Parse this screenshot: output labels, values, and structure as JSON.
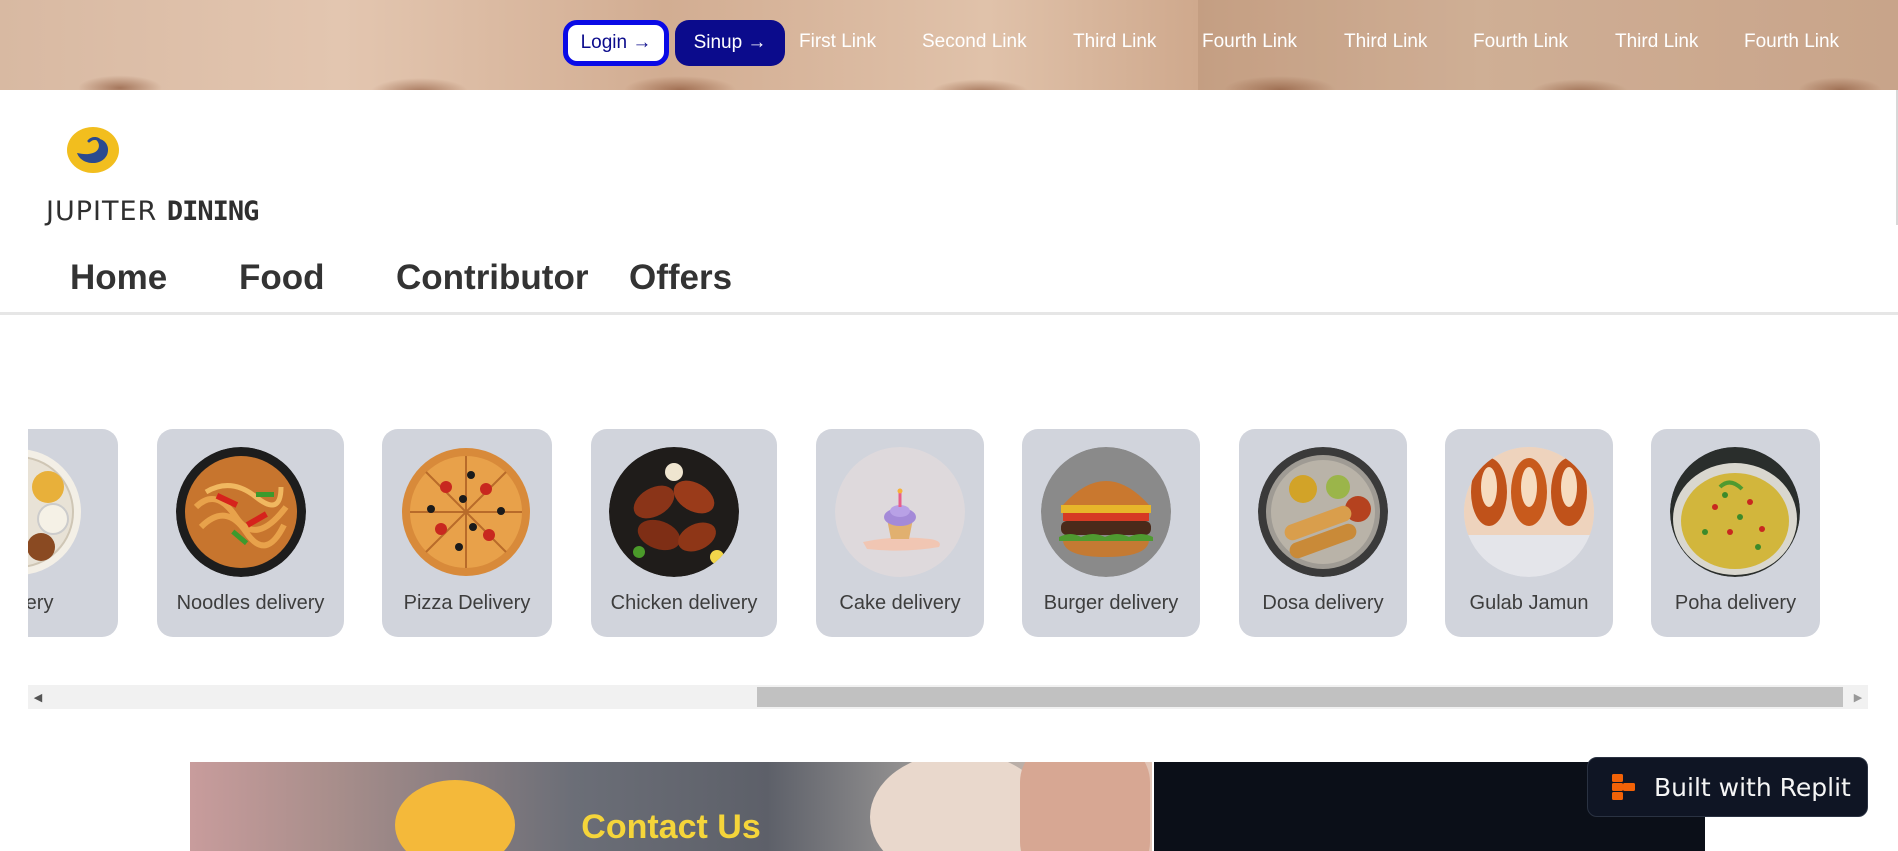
{
  "topbar": {
    "login_label": "Login →",
    "signup_label": "Sinup →",
    "links": [
      "First Link",
      "Second Link",
      "Third Link",
      "Fourth Link",
      "Third Link",
      "Fourth Link",
      "Third Link",
      "Fourth Link"
    ]
  },
  "brand": {
    "name_part1": "JUPITER ",
    "name_part2": "DINING",
    "logo_icon": "jupiter-logo-icon"
  },
  "mainnav": {
    "items": [
      "Home",
      "Food",
      "Contributor",
      "Offers"
    ]
  },
  "carousel": {
    "items": [
      {
        "label": "delivery",
        "icon": "thali-icon"
      },
      {
        "label": "Noodles delivery",
        "icon": "noodles-icon"
      },
      {
        "label": "Pizza Delivery",
        "icon": "pizza-icon"
      },
      {
        "label": "Chicken delivery",
        "icon": "chicken-icon"
      },
      {
        "label": "Cake delivery",
        "icon": "cake-icon"
      },
      {
        "label": "Burger delivery",
        "icon": "burger-icon"
      },
      {
        "label": "Dosa delivery",
        "icon": "dosa-icon"
      },
      {
        "label": "Gulab Jamun",
        "icon": "gulab-jamun-icon"
      },
      {
        "label": "Poha delivery",
        "icon": "poha-icon"
      }
    ]
  },
  "contact": {
    "title": "Contact Us"
  },
  "badge": {
    "label": "Built with Replit"
  },
  "colors": {
    "accent_blue": "#0a0ae6",
    "navy": "#0b0b8c",
    "card_bg": "#d1d4dc",
    "contact_title": "#f5d53a",
    "logo_yellow": "#f2be1e"
  }
}
